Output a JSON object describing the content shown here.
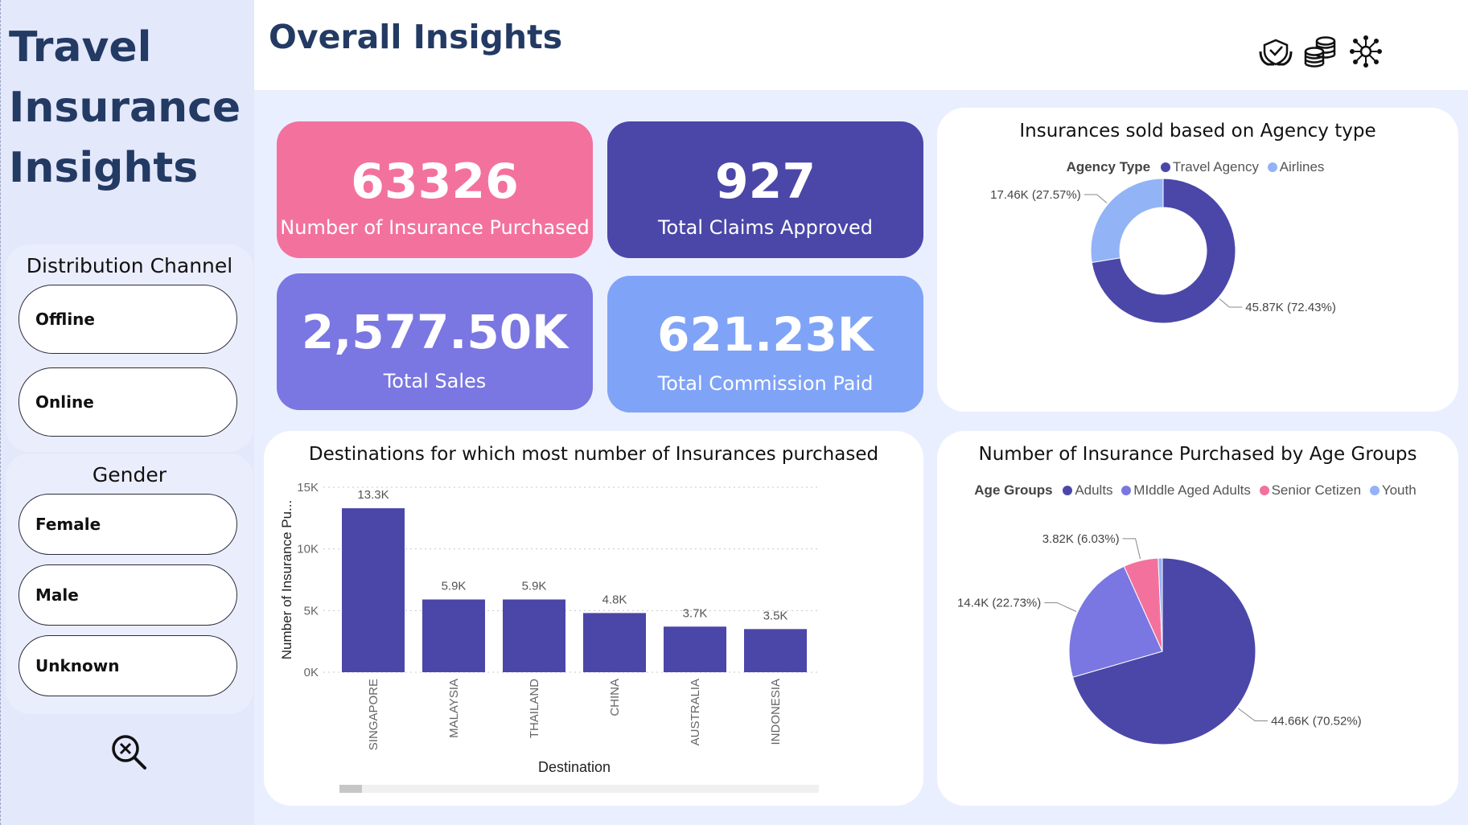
{
  "app": {
    "title_lines": [
      "Travel",
      "Insurance",
      "Insights"
    ],
    "page_title": "Overall Insights"
  },
  "header_icons": [
    "insurance-hands-icon",
    "coins-stack-icon",
    "network-hub-icon"
  ],
  "slicers": {
    "distribution": {
      "title": "Distribution Channel",
      "options": [
        "Offline",
        "Online"
      ]
    },
    "gender": {
      "title": "Gender",
      "options": [
        "Female",
        "Male",
        "Unknown"
      ]
    },
    "clear_icon": "clear-filters-icon"
  },
  "kpis": [
    {
      "value": "63326",
      "label": "Number of Insurance Purchased",
      "color": "#f3729d"
    },
    {
      "value": "927",
      "label": "Total Claims Approved",
      "color": "#4b47a8"
    },
    {
      "value": "2,577.50K",
      "label": "Total Sales",
      "color": "#7a76e2"
    },
    {
      "value": "621.23K",
      "label": "Total Commission Paid",
      "color": "#7fa3f7"
    }
  ],
  "colors": {
    "dark_purple": "#4b47a8",
    "medium_purple": "#7a76e2",
    "pink": "#f3729d",
    "light_blue": "#93b3f7",
    "title_navy": "#233a63"
  },
  "chart_data": [
    {
      "id": "agency",
      "type": "pie",
      "variant": "donut",
      "title": "Insurances sold based on Agency type",
      "legend_title": "Agency Type",
      "labels": [
        "Travel Agency",
        "Airlines"
      ],
      "values": [
        45.87,
        17.46
      ],
      "percents": [
        72.43,
        27.57
      ],
      "data_labels": [
        "45.87K (72.43%)",
        "17.46K (27.57%)"
      ],
      "colors": [
        "#4b47a8",
        "#93b3f7"
      ]
    },
    {
      "id": "destinations",
      "type": "bar",
      "title": "Destinations for which most number of Insurances purchased",
      "xlabel": "Destination",
      "ylabel": "Number of Insurance Pu...",
      "categories": [
        "SINGAPORE",
        "MALAYSIA",
        "THAILAND",
        "CHINA",
        "AUSTRALIA",
        "INDONESIA"
      ],
      "values": [
        13.3,
        5.9,
        5.9,
        4.8,
        3.7,
        3.5
      ],
      "data_labels": [
        "13.3K",
        "5.9K",
        "5.9K",
        "4.8K",
        "3.7K",
        "3.5K"
      ],
      "yticks": [
        "0K",
        "5K",
        "10K",
        "15K"
      ],
      "ylim": [
        0,
        15
      ],
      "grid": true,
      "color": "#4b47a8"
    },
    {
      "id": "age",
      "type": "pie",
      "title": "Number of Insurance Purchased by Age Groups",
      "legend_title": "Age Groups",
      "labels": [
        "Adults",
        "MIddle Aged Adults",
        "Senior Cetizen",
        "Youth"
      ],
      "values": [
        44.66,
        14.4,
        3.82,
        0.45
      ],
      "percents": [
        70.52,
        22.73,
        6.03,
        0.72
      ],
      "data_labels": [
        "44.66K (70.52%)",
        "14.4K (22.73%)",
        "3.82K (6.03%)",
        ""
      ],
      "colors": [
        "#4b47a8",
        "#7a76e2",
        "#f3729d",
        "#93b3f7"
      ]
    }
  ]
}
